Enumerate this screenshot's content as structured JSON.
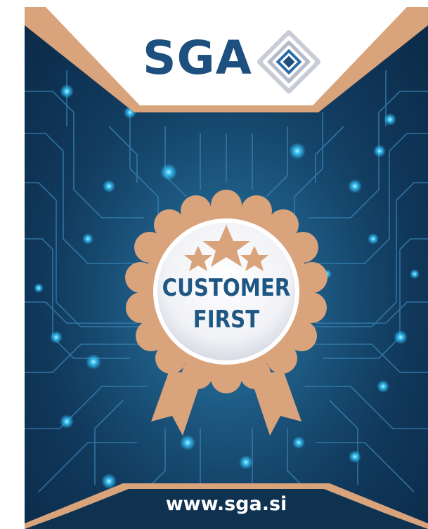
{
  "brand": {
    "name": "SGA",
    "logo_icon": "diamond-squares-icon"
  },
  "badge": {
    "line1": "CUSTOMER",
    "line2": "FIRST",
    "stars": 3,
    "icon": "rosette-award-icon"
  },
  "footer": {
    "url": "www.sga.si"
  },
  "colors": {
    "navy": "#1d4f7f",
    "background": "#0f3557",
    "glow": "#35c8ff",
    "copper": "#d9a37c",
    "copper_light": "#e8b995",
    "white": "#ffffff"
  }
}
